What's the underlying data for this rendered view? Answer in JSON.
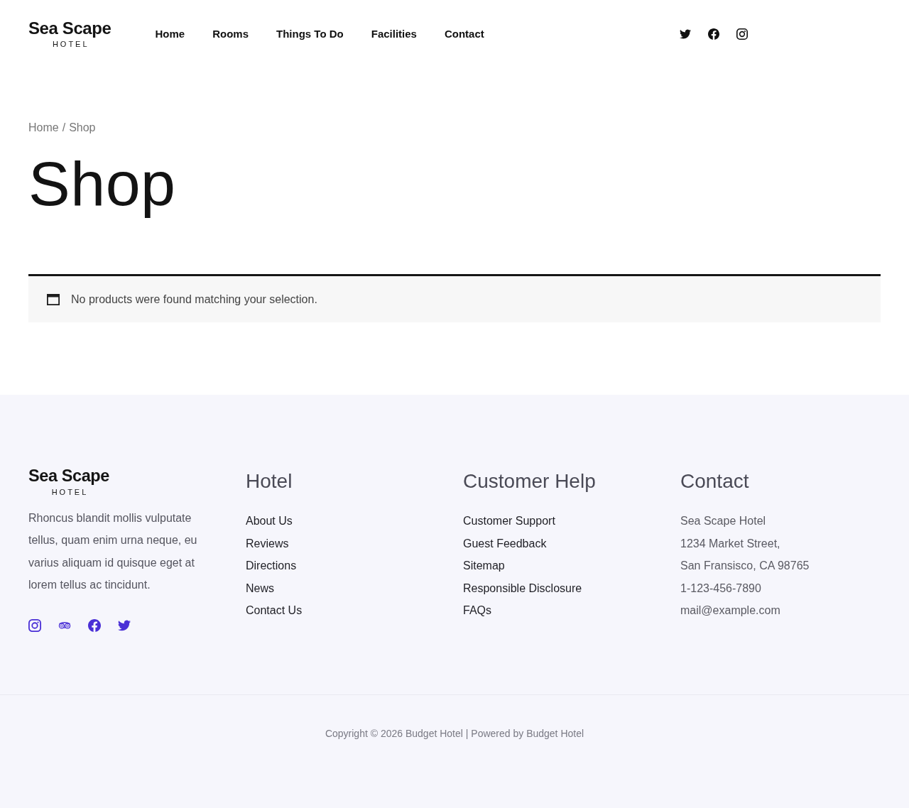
{
  "header": {
    "logo": {
      "name": "Sea Scape",
      "tagline": "HOTEL"
    },
    "nav": [
      "Home",
      "Rooms",
      "Things To Do",
      "Facilities",
      "Contact"
    ]
  },
  "breadcrumb": {
    "items": [
      "Home",
      "Shop"
    ],
    "separator": "/"
  },
  "page_title": "Shop",
  "notice": {
    "message": "No products were found matching your selection."
  },
  "footer": {
    "logo": {
      "name": "Sea Scape",
      "tagline": "HOTEL"
    },
    "description": "Rhoncus blandit mollis vulputate tellus, quam enim urna neque, eu varius aliquam id quisque eget at lorem tellus ac tincidunt.",
    "columns": [
      {
        "kind": "links",
        "title": "Hotel",
        "items": [
          "About Us",
          "Reviews",
          "Directions",
          "News",
          "Contact Us"
        ]
      },
      {
        "kind": "links",
        "title": "Customer Help",
        "items": [
          "Customer Support",
          "Guest Feedback",
          "Sitemap",
          "Responsible Disclosure",
          "FAQs"
        ]
      },
      {
        "kind": "address",
        "title": "Contact",
        "items": [
          "Sea Scape Hotel",
          "1234 Market Street,",
          "San Fransisco, CA 98765",
          "1-123-456-7890",
          "mail@example.com"
        ]
      }
    ],
    "copyright": "Copyright © 2026 Budget Hotel | Powered by Budget Hotel"
  }
}
